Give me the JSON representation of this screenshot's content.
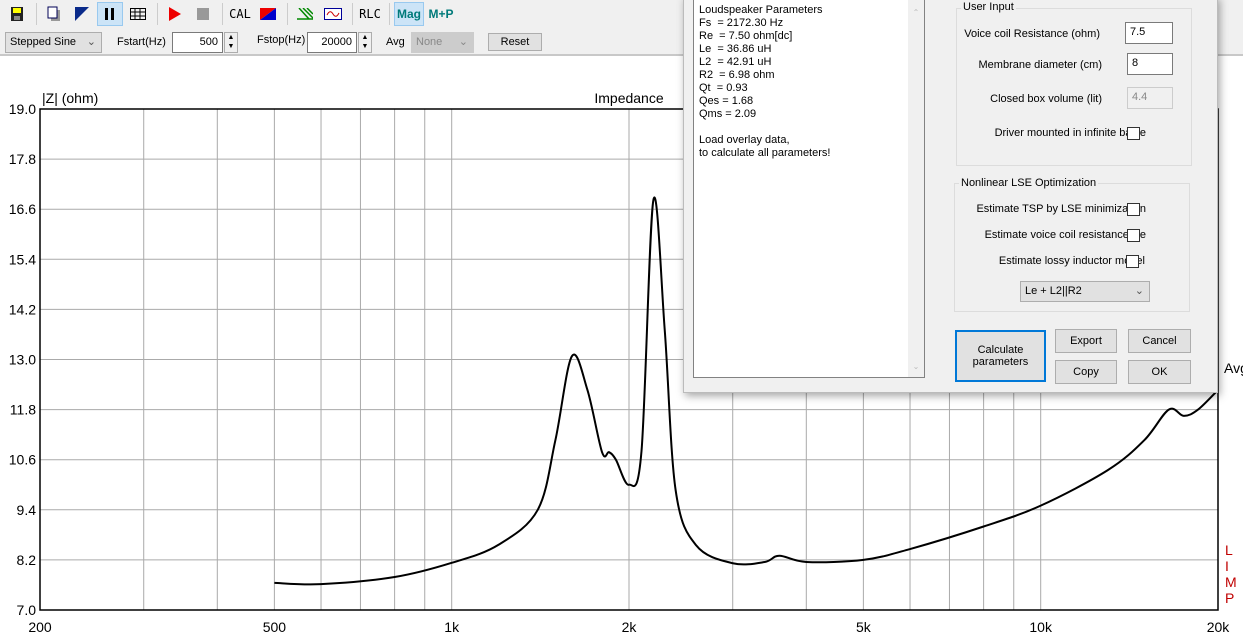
{
  "toolbar": {
    "items": [
      {
        "icon": "save-icon"
      },
      {
        "icon": "new-document-icon"
      },
      {
        "icon": "contrast-icon"
      },
      {
        "icon": "pause-icon",
        "active": true
      },
      {
        "icon": "table-icon"
      },
      {
        "icon": "play-icon"
      },
      {
        "icon": "stop-icon"
      },
      {
        "label": "CAL"
      },
      {
        "icon": "calibration-color-icon"
      },
      {
        "icon": "filter-icon"
      },
      {
        "icon": "waveform-icon"
      },
      {
        "label": "RLC"
      },
      {
        "label": "Mag",
        "active": true
      },
      {
        "label": "M+P"
      }
    ]
  },
  "controls": {
    "mode": "Stepped Sine",
    "fstart_label": "Fstart(Hz)",
    "fstart": "500",
    "fstop_label": "Fstop(Hz)",
    "fstop": "20000",
    "avg_label": "Avg",
    "avg": "None",
    "reset": "Reset"
  },
  "dialog": {
    "results": "Loudspeaker Parameters\nFs  = 2172.30 Hz\nRe  = 7.50 ohm[dc]\nLe  = 36.86 uH\nL2  = 42.91 uH\nR2  = 6.98 ohm\nQt  = 0.93\nQes = 1.68\nQms = 2.09\n\nLoad overlay data,\nto calculate all parameters!",
    "user_input_title": "User Input",
    "vc_label": "Voice coil Resistance (ohm)",
    "vc_value": "7.5",
    "diam_label": "Membrane diameter (cm)",
    "diam_value": "8",
    "box_label": "Closed box volume (lit)",
    "box_value": "4.4",
    "baffle_label": "Driver mounted in infinite baffle",
    "lse_title": "Nonlinear LSE Optimization",
    "lse_tsp": "Estimate TSP by LSE minimization",
    "lse_re": "Estimate voice coil resistance Re",
    "lse_lossy": "Estimate lossy inductor model",
    "model": "Le + L2||R2",
    "calc": "Calculate parameters",
    "export": "Export",
    "cancel": "Cancel",
    "copy": "Copy",
    "ok": "OK"
  },
  "chart_data": {
    "type": "line",
    "title": "Impedance",
    "ylabel": "|Z| (ohm)",
    "xscale": "log",
    "xlim": [
      200,
      20000
    ],
    "ylim": [
      7.0,
      19.0
    ],
    "xticks": [
      {
        "v": 200,
        "l": "200"
      },
      {
        "v": 500,
        "l": "500"
      },
      {
        "v": 1000,
        "l": "1k"
      },
      {
        "v": 2000,
        "l": "2k"
      },
      {
        "v": 5000,
        "l": "5k"
      },
      {
        "v": 10000,
        "l": "10k"
      },
      {
        "v": 20000,
        "l": "20k"
      }
    ],
    "yticks": [
      "7.0",
      "8.2",
      "9.4",
      "10.6",
      "11.8",
      "13.0",
      "14.2",
      "15.4",
      "16.6",
      "17.8",
      "19.0"
    ],
    "grid": true,
    "right_labels": {
      "avg": "Avg",
      "mode": "LIMP"
    },
    "line_color": "#000000",
    "mode_color": "#c00000",
    "x": [
      500,
      600,
      800,
      1000,
      1200,
      1400,
      1500,
      1600,
      1700,
      1800,
      1850,
      1900,
      2000,
      2100,
      2200,
      2300,
      2400,
      2600,
      3000,
      3400,
      3600,
      4000,
      5000,
      6000,
      8000,
      10000,
      13000,
      15000,
      16500,
      17500,
      18500,
      20000
    ],
    "y": [
      7.65,
      7.62,
      7.79,
      8.13,
      8.56,
      9.4,
      11.07,
      13.08,
      12.27,
      10.78,
      10.78,
      10.6,
      10.0,
      10.8,
      16.82,
      13.7,
      9.87,
      8.55,
      8.12,
      8.15,
      8.3,
      8.15,
      8.2,
      8.46,
      9.0,
      9.5,
      10.35,
      11.07,
      11.8,
      11.65,
      11.8,
      12.27
    ]
  }
}
